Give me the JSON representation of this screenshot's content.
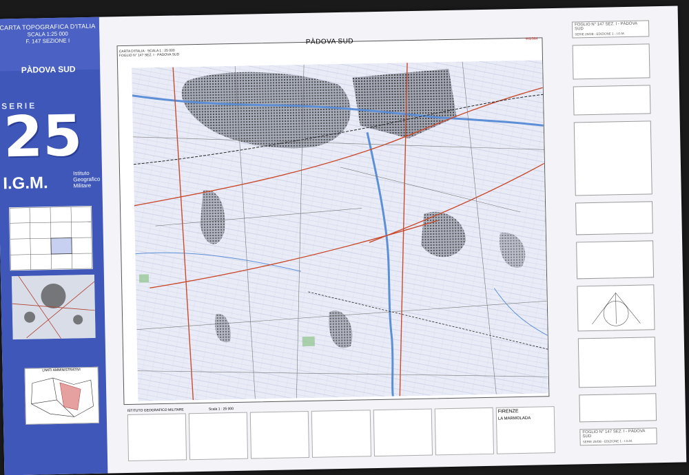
{
  "cover": {
    "line1": "CARTA TOPOGRAFICA D'ITALIA",
    "line2": "SCALA 1:25 000",
    "line3": "F. 147 SEZIONE I",
    "title": "PÀDOVA SUD",
    "serie": "SERIE",
    "serie_number": "25",
    "igm": "I.G.M.",
    "igm_sub": [
      "Istituto",
      "Geografico",
      "Militare"
    ]
  },
  "map": {
    "title": "PÀDOVA SUD",
    "subtitle_left": "CARTA D'ITALIA · SCALA 1 : 25 000",
    "subtitle_small": "FOGLIO N° 147 SEZ. I · PÀDOVA SUD",
    "datum": "WGS84"
  },
  "right_panel": {
    "header": "FOGLIO N° 147 SEZ. I - PÀDOVA SUD",
    "header_sub": "SERIE 25/DB - EDIZIONE 1 - I.G.M.",
    "footer": "FOGLIO N° 147 SEZ. I - PÀDOVA SUD",
    "footer_sub": "SERIE 25/DB - EDIZIONE 1 - I.G.M."
  },
  "bottom": {
    "limiti": "LIMITI AMMINISTRATIVI",
    "istituto": "ISTITUTO GEOGRAFICO MILITARE",
    "scale": "Scala 1 : 25 000",
    "cities": [
      "FIRENZE",
      "LA MARMOLADA"
    ]
  },
  "colors": {
    "cover_blue": "#3f57b8",
    "map_bg": "#e8ebf6",
    "road_red": "#c94a2c",
    "water_blue": "#5c8fd6",
    "urban_dark": "#2b2b2b"
  }
}
